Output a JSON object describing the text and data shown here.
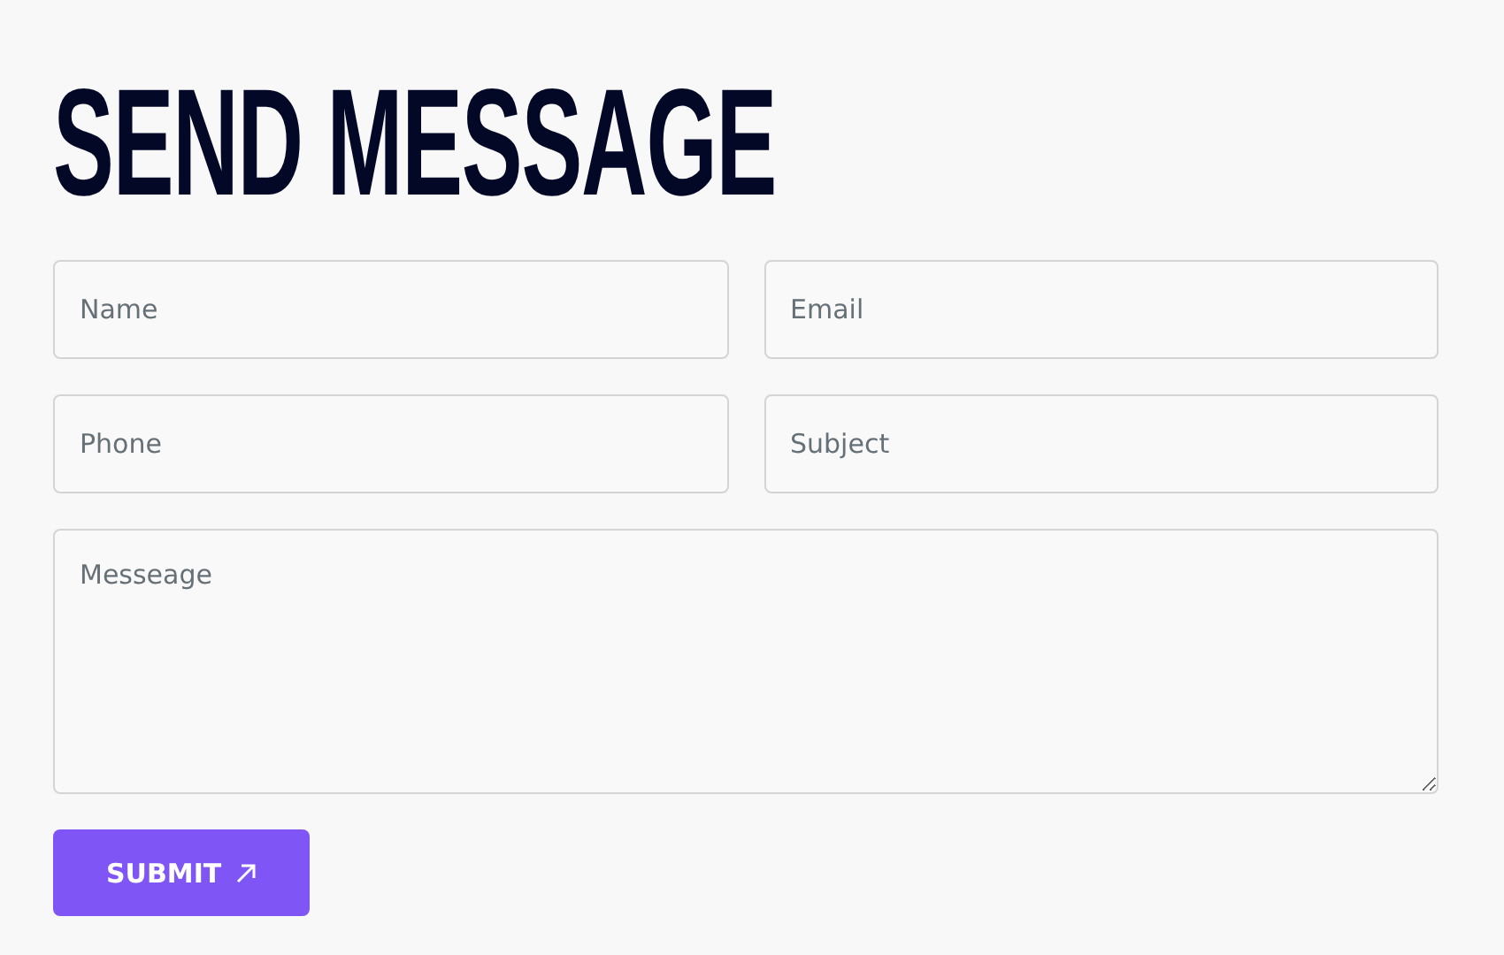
{
  "title": "SEND MESSAGE",
  "fields": [
    {
      "placeholder": "Name"
    },
    {
      "placeholder": "Email"
    },
    {
      "placeholder": "Phone"
    },
    {
      "placeholder": "Subject"
    }
  ],
  "message": {
    "placeholder": "Messeage"
  },
  "submit": {
    "label": "SUBMIT"
  }
}
